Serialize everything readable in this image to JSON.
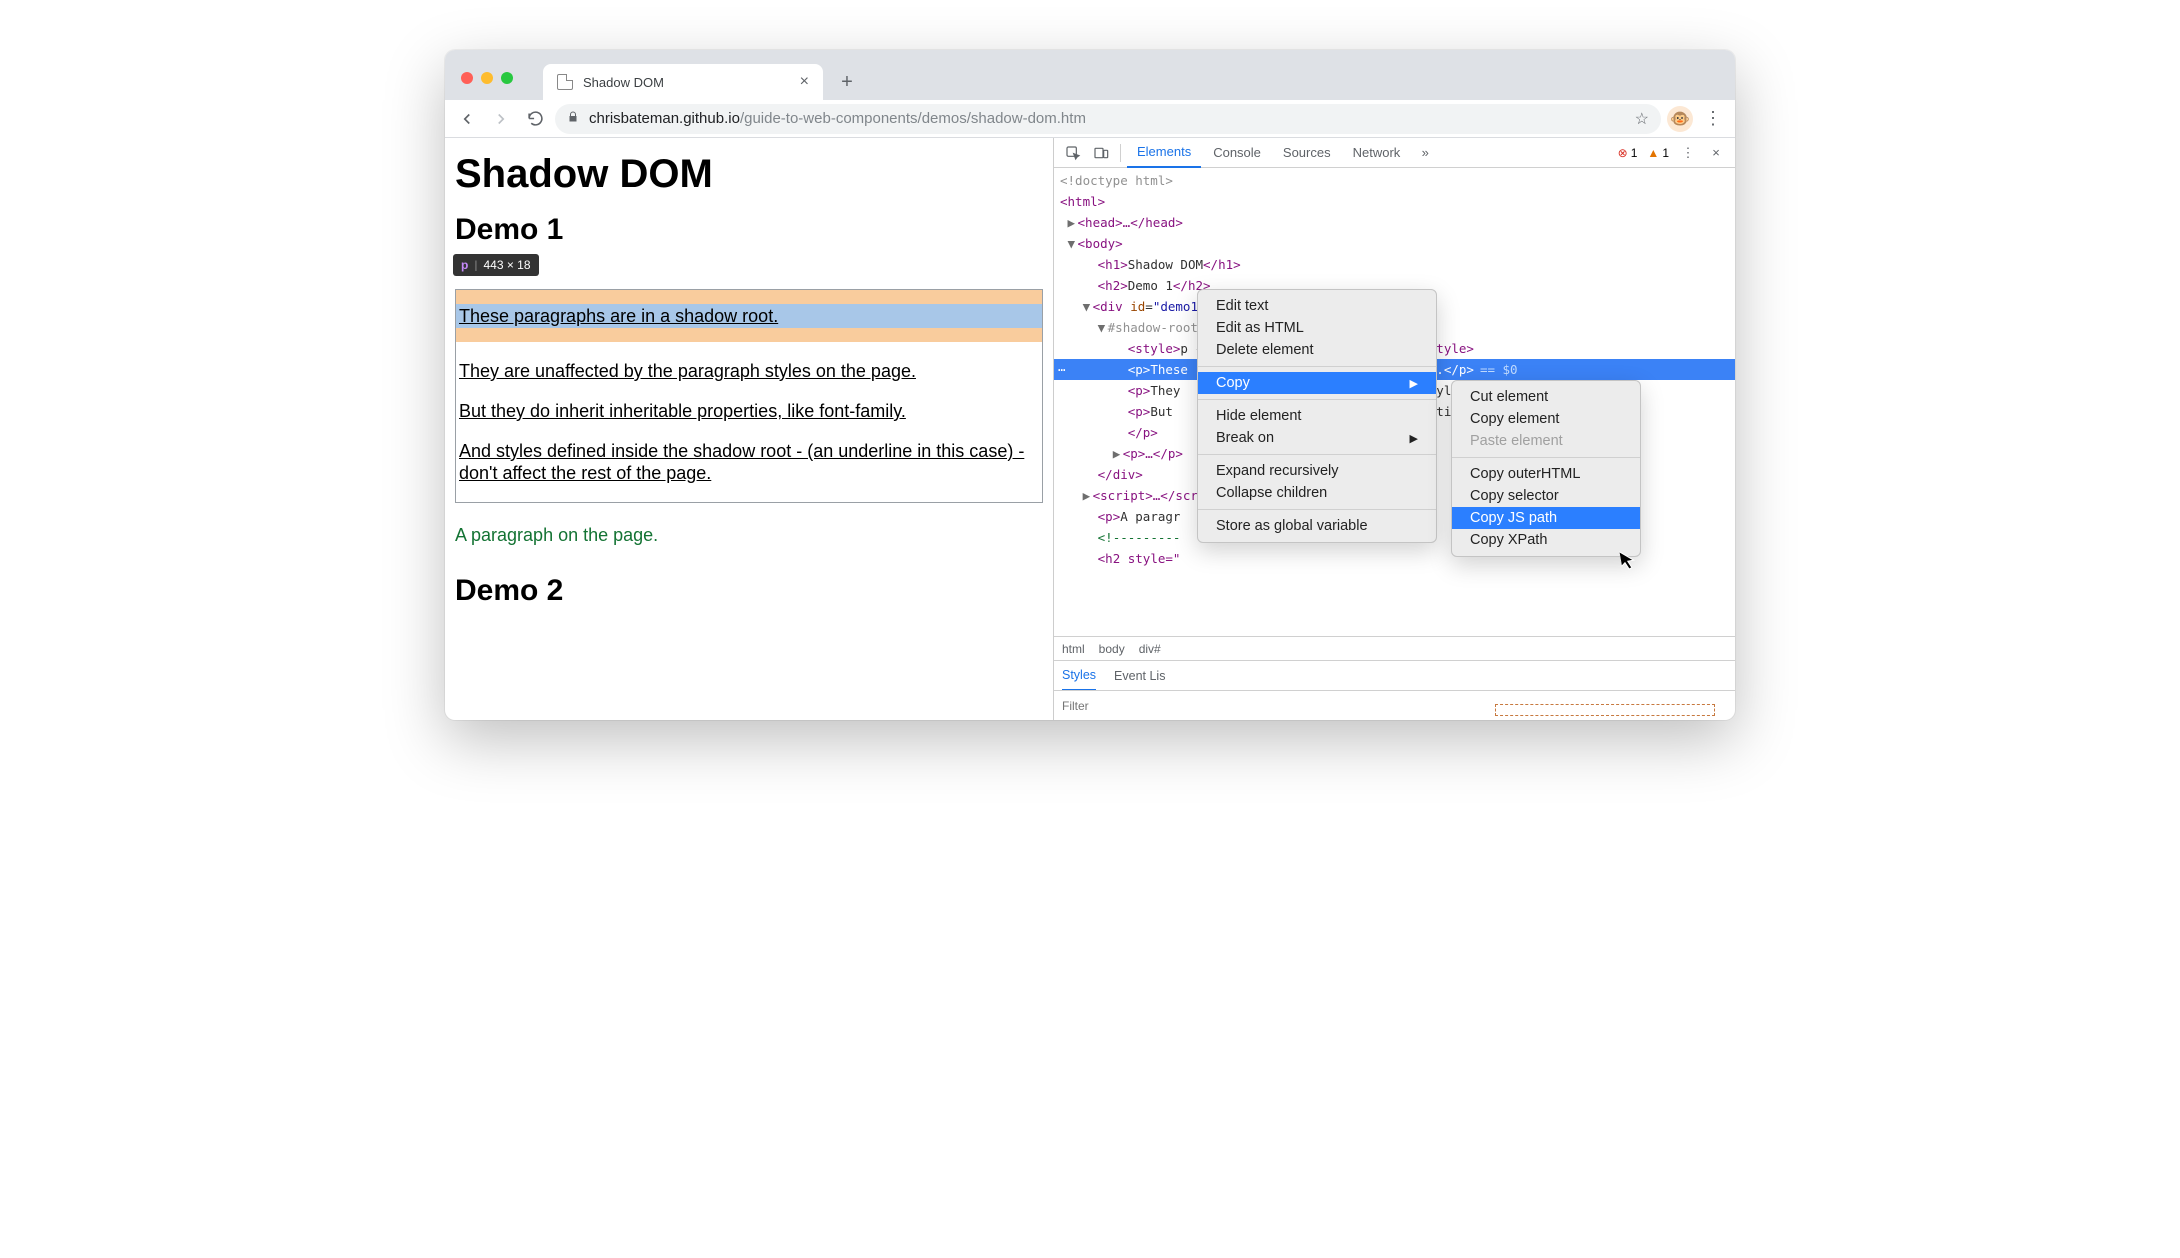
{
  "browser": {
    "tab_title": "Shadow DOM",
    "url_host": "chrisbateman.github.io",
    "url_path": "/guide-to-web-components/demos/shadow-dom.htm",
    "avatar_emoji": "🐵"
  },
  "page": {
    "h1": "Shadow DOM",
    "h2_1": "Demo 1",
    "h2_2": "Demo 2",
    "tooltip_tag": "p",
    "tooltip_dims": "443 × 18",
    "shadow_p1": "These paragraphs are in a shadow root.",
    "shadow_p2": "They are unaffected by the paragraph styles on the page.",
    "shadow_p3": "But they do inherit inheritable properties, like font-family.",
    "shadow_p4": "And styles defined inside the shadow root - (an underline in this case) - don't affect the rest of the page.",
    "body_p": "A paragraph on the page."
  },
  "devtools": {
    "tabs": {
      "elements": "Elements",
      "console": "Console",
      "sources": "Sources",
      "network": "Network"
    },
    "error_count": "1",
    "warn_count": "1",
    "tree": {
      "doctype": "<!doctype html>",
      "html_open": "<html>",
      "head": "<head>…</head>",
      "body_open": "<body>",
      "h1": "<h1>Shadow DOM</h1>",
      "h2_1": "<h2>Demo 1</h2>",
      "div_open_a": "<div id=\"",
      "div_open_b": "demo1",
      "div_open_c": "\">",
      "shadow_root": "#shadow-root (open)",
      "style_line_a": "<style>",
      "style_line_b": "p {text-decoration: underline;}",
      "style_line_c": "</style>",
      "p_sel_a": "<p>",
      "p_sel_b": "These",
      "p_sel_c": "root.",
      "p_sel_d": "</p>",
      "p_sel_dollar": "== $0",
      "p2_a": "<p>",
      "p2_b": "They",
      "p2_c": "aph styles on the page.",
      "p2_d": "</p>",
      "p3_a": "<p>",
      "p3_b": "But",
      "p3_c": "roperties, like font-family.",
      "p3_d": "</p>",
      "p_empty": "</p>",
      "p_coll": "<p>…</p>",
      "div_close": "</div>",
      "script": "<script>…</",
      "script_end": "script>",
      "body_p_a": "<p>",
      "body_p_b": "A paragr",
      "comment": "<!---------",
      "h2_style": "<h2 style=\""
    },
    "crumbs": {
      "html": "html",
      "body": "body",
      "div": "div#"
    },
    "subtabs": {
      "styles": "Styles",
      "events": "Event Lis"
    },
    "filter_placeholder": "Filter"
  },
  "context": {
    "edit_text": "Edit text",
    "edit_html": "Edit as HTML",
    "delete": "Delete element",
    "copy": "Copy",
    "hide": "Hide element",
    "break": "Break on",
    "expand": "Expand recursively",
    "collapse": "Collapse children",
    "store": "Store as global variable",
    "sub": {
      "cut": "Cut element",
      "copy_el": "Copy element",
      "paste": "Paste element",
      "outer": "Copy outerHTML",
      "selector": "Copy selector",
      "jspath": "Copy JS path",
      "xpath": "Copy XPath"
    }
  }
}
